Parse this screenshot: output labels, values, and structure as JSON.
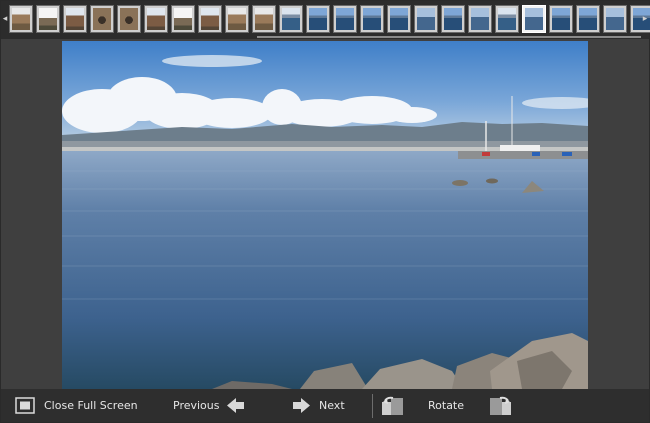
{
  "toolbar": {
    "close_full_screen": "Close Full Screen",
    "previous": "Previous",
    "next": "Next",
    "rotate": "Rotate"
  },
  "filmstrip": {
    "thumbnails": [
      "ruin",
      "ruin2",
      "church",
      "arch",
      "arch",
      "church",
      "ruin2",
      "church",
      "ruin",
      "ruin",
      "sea3",
      "sea",
      "sea",
      "sea",
      "sea",
      "sea2",
      "sea",
      "sea2",
      "sea3",
      "sea2",
      "sea",
      "sea",
      "sea2",
      "sea"
    ],
    "selected_index": 19
  },
  "colors": {
    "background": "#3f3f3f",
    "toolbar": "#2e2e2e",
    "filmstrip": "#2c2c2c",
    "text": "#e6e6e6"
  },
  "icons": [
    "close-full-screen-icon",
    "previous-arrow-icon",
    "next-arrow-icon",
    "rotate-left-icon",
    "rotate-right-icon",
    "strip-scroll-left-icon",
    "strip-scroll-right-icon"
  ]
}
